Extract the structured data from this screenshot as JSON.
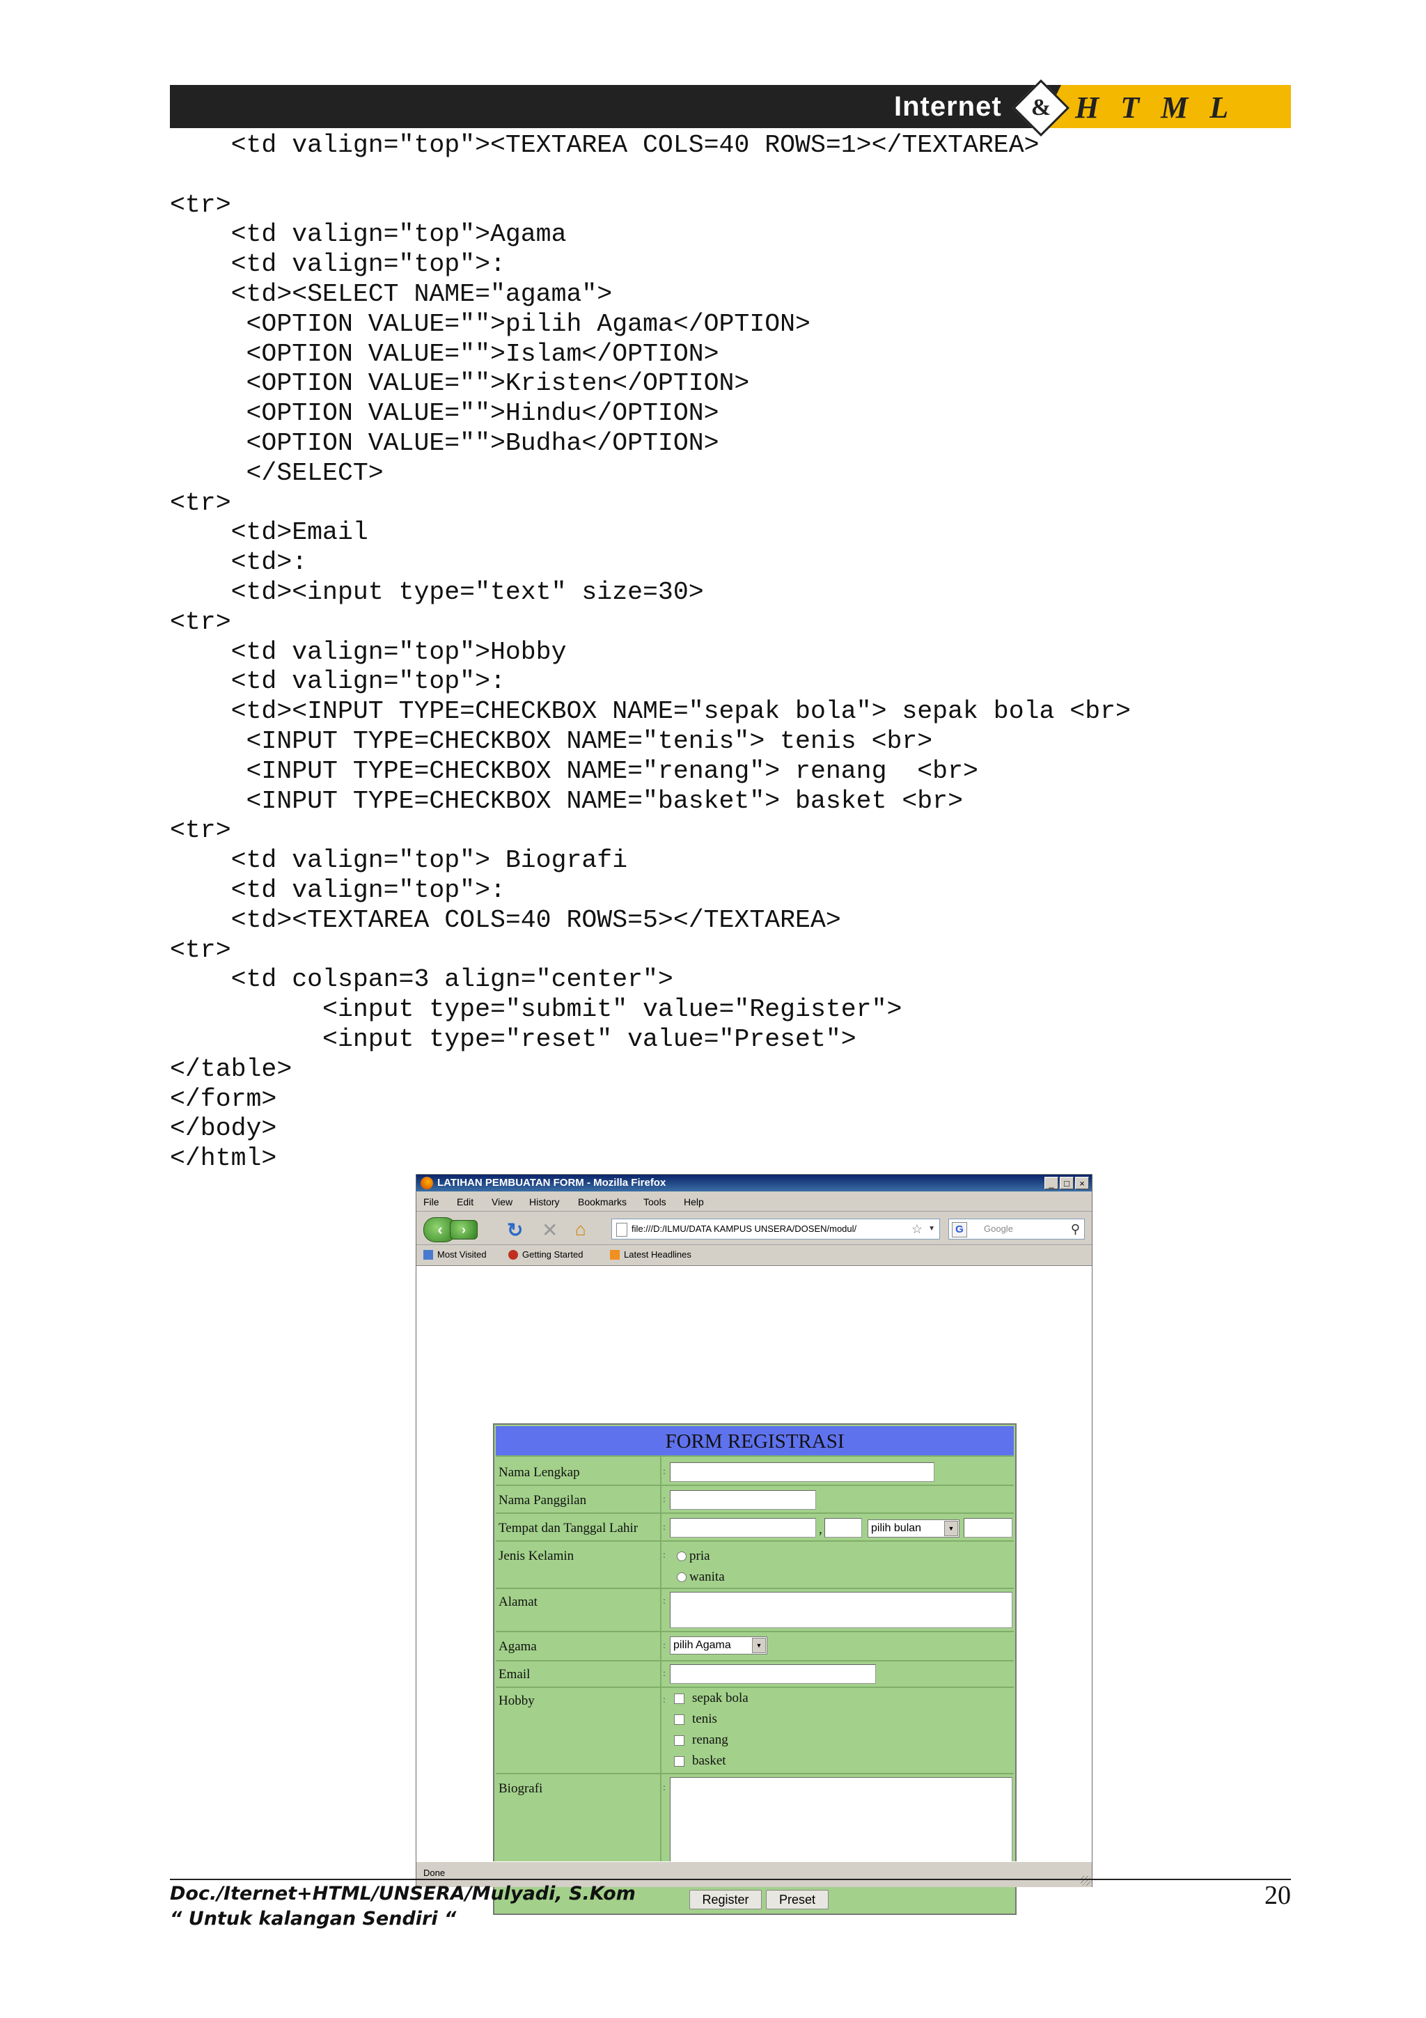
{
  "header": {
    "brand_internet": "Internet",
    "brand_amp": "&",
    "brand_html": "H T M L"
  },
  "code_lines": [
    "    <td valign=\"top\"><TEXTAREA COLS=40 ROWS=1></TEXTAREA>",
    "",
    "<tr>",
    "    <td valign=\"top\">Agama",
    "    <td valign=\"top\">:",
    "    <td><SELECT NAME=\"agama\">",
    "     <OPTION VALUE=\"\">pilih Agama</OPTION>",
    "     <OPTION VALUE=\"\">Islam</OPTION>",
    "     <OPTION VALUE=\"\">Kristen</OPTION>",
    "     <OPTION VALUE=\"\">Hindu</OPTION>",
    "     <OPTION VALUE=\"\">Budha</OPTION>",
    "     </SELECT>",
    "<tr>",
    "    <td>Email",
    "    <td>:",
    "    <td><input type=\"text\" size=30>",
    "<tr>",
    "    <td valign=\"top\">Hobby",
    "    <td valign=\"top\">:",
    "    <td><INPUT TYPE=CHECKBOX NAME=\"sepak bola\"> sepak bola <br>",
    "     <INPUT TYPE=CHECKBOX NAME=\"tenis\"> tenis <br>",
    "     <INPUT TYPE=CHECKBOX NAME=\"renang\"> renang  <br>",
    "     <INPUT TYPE=CHECKBOX NAME=\"basket\"> basket <br>",
    "<tr>",
    "    <td valign=\"top\"> Biografi",
    "    <td valign=\"top\">:",
    "    <td><TEXTAREA COLS=40 ROWS=5></TEXTAREA>",
    "<tr>",
    "    <td colspan=3 align=\"center\">",
    "          <input type=\"submit\" value=\"Register\">",
    "          <input type=\"reset\" value=\"Preset\">",
    "</table>",
    "</form>",
    "</body>",
    "</html>"
  ],
  "browser": {
    "title": "LATIHAN PEMBUATAN FORM - Mozilla Firefox",
    "menu": [
      "File",
      "Edit",
      "View",
      "History",
      "Bookmarks",
      "Tools",
      "Help"
    ],
    "url": "file:///D:/ILMU/DATA KAMPUS UNSERA/DOSEN/modul/",
    "search_placeholder": "Google",
    "bookmarks": [
      "Most Visited",
      "Getting Started",
      "Latest Headlines"
    ],
    "status": "Done",
    "form": {
      "title": "FORM REGISTRASI",
      "labels": {
        "nama_lengkap": "Nama Lengkap",
        "nama_panggilan": "Nama Panggilan",
        "ttl": "Tempat dan Tanggal Lahir",
        "jenis_kelamin": "Jenis Kelamin",
        "alamat": "Alamat",
        "agama": "Agama",
        "email": "Email",
        "hobby": "Hobby",
        "biografi": "Biografi"
      },
      "colon": ":",
      "comma": ",",
      "bulan_select": "pilih bulan",
      "agama_select": "pilih Agama",
      "radios": [
        "pria",
        "wanita"
      ],
      "hobbies": [
        "sepak bola",
        "tenis",
        "renang",
        "basket"
      ],
      "register_label": "Register",
      "preset_label": "Preset"
    }
  },
  "footer": {
    "doc": "Doc./Iternet+HTML/UNSERA/Mulyadi, S.Kom",
    "note": "“ Untuk kalangan Sendiri “",
    "page": "20"
  }
}
